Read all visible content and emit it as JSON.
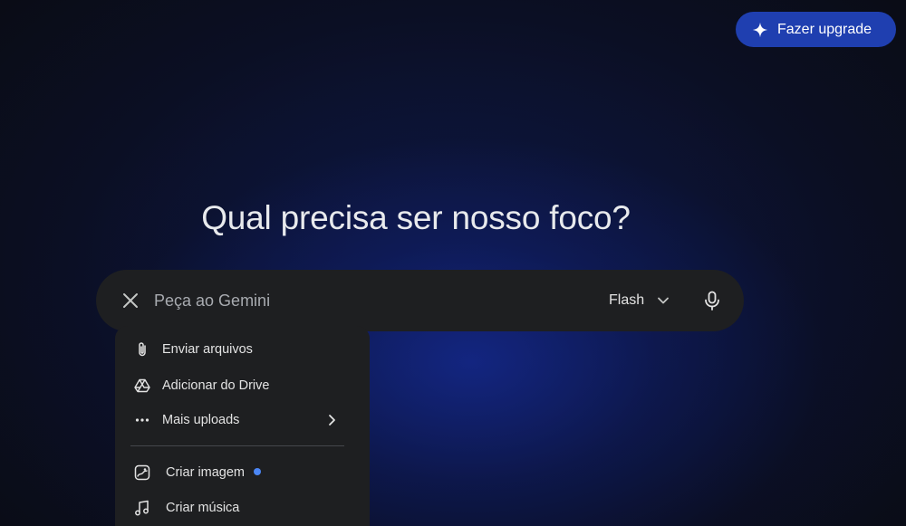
{
  "header": {
    "upgrade_label": "Fazer upgrade",
    "upgrade_icon": "sparkle-icon",
    "upgrade_color": "#1f3fb0"
  },
  "main": {
    "headline": "Qual precisa ser nosso foco?"
  },
  "prompt": {
    "placeholder": "Peça ao Gemini",
    "value": "",
    "close_icon": "close-icon",
    "model_label": "Flash",
    "model_icon": "chevron-down-icon",
    "mic_icon": "microphone-icon"
  },
  "menu": {
    "upload_items": [
      {
        "label": "Enviar arquivos",
        "icon": "paperclip-icon"
      },
      {
        "label": "Adicionar do Drive",
        "icon": "drive-icon"
      },
      {
        "label": "Mais uploads",
        "icon": "more-horizontal-icon",
        "submenu": true
      }
    ],
    "tool_items": [
      {
        "label": "Criar imagem",
        "icon": "image-create-icon",
        "badge_color": "#4b86f5"
      },
      {
        "label": "Criar música",
        "icon": "music-note-icon"
      }
    ]
  },
  "colors": {
    "background": "#0c0d12",
    "glow": "#1428a0",
    "surface": "#1e1f21",
    "text": "#e3e3e3"
  }
}
